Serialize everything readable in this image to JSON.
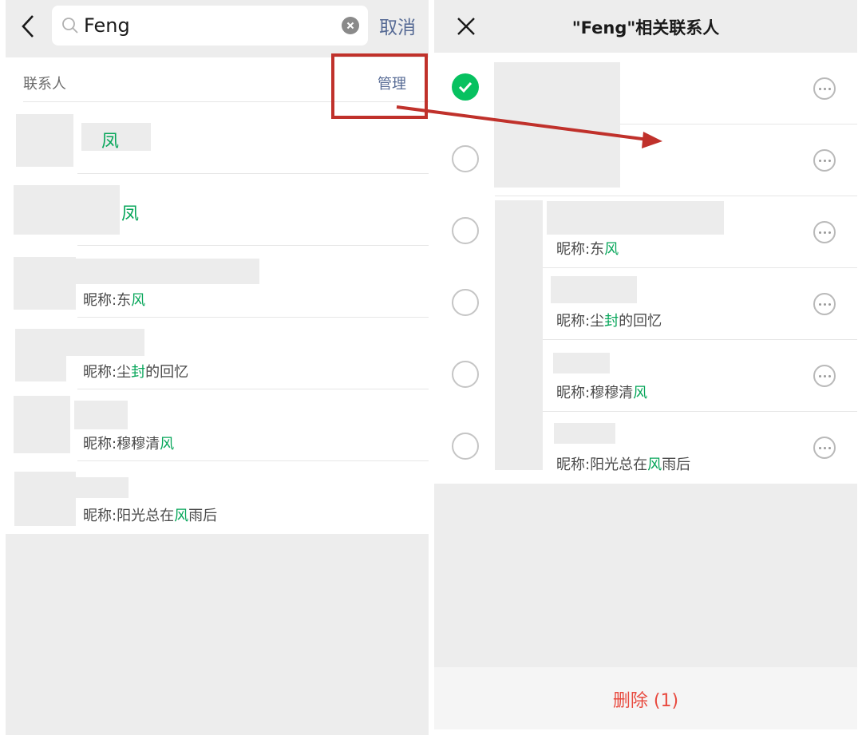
{
  "left": {
    "search": {
      "value": "Feng",
      "cancel_label": "取消"
    },
    "section": {
      "title": "联系人",
      "manage_label": "管理"
    },
    "contacts": [
      {
        "name_highlight": "凤"
      },
      {
        "name_highlight": "凤"
      },
      {
        "nick_prefix": "昵称:东",
        "nick_highlight": "风",
        "nick_suffix": ""
      },
      {
        "nick_prefix": "昵称:尘",
        "nick_highlight": "封",
        "nick_suffix": "的回忆"
      },
      {
        "nick_prefix": "昵称:穆穆清",
        "nick_highlight": "风",
        "nick_suffix": ""
      },
      {
        "nick_prefix": "昵称:阳光总在",
        "nick_highlight": "风",
        "nick_suffix": "雨后"
      }
    ]
  },
  "right": {
    "title": "\"Feng\"相关联系人",
    "delete_label": "删除 (1)",
    "rows": [
      {
        "checked": true
      },
      {
        "checked": false
      },
      {
        "checked": false,
        "nick_prefix": "昵称:东",
        "nick_highlight": "风",
        "nick_suffix": ""
      },
      {
        "checked": false,
        "nick_prefix": "昵称:尘",
        "nick_highlight": "封",
        "nick_suffix": "的回忆"
      },
      {
        "checked": false,
        "nick_prefix": "昵称:穆穆清",
        "nick_highlight": "风",
        "nick_suffix": ""
      },
      {
        "checked": false,
        "nick_prefix": "昵称:阳光总在",
        "nick_highlight": "风",
        "nick_suffix": "雨后"
      }
    ]
  },
  "colors": {
    "accent_green": "#07c160",
    "link_blue": "#576b95",
    "danger_red": "#e84a3f",
    "annotation_red": "#c0312b"
  },
  "icons": {
    "back": "chevron-left-icon",
    "search": "search-icon",
    "clear": "clear-icon",
    "close": "close-icon",
    "more": "more-icon",
    "check": "check-icon"
  }
}
